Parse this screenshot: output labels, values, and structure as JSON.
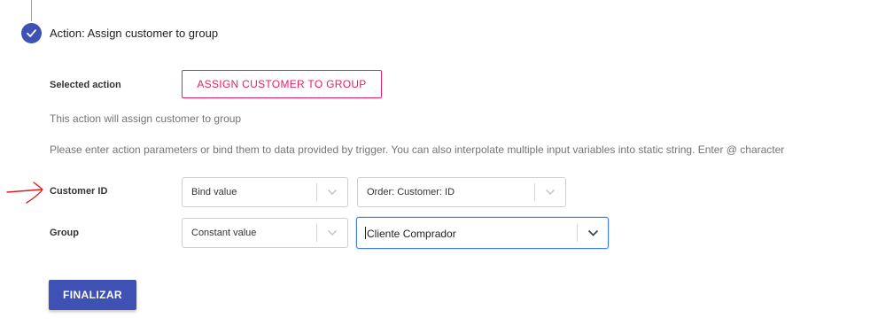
{
  "step": {
    "title": "Action: Assign customer to group",
    "icon": "check-icon",
    "status_color": "#3f51b5"
  },
  "selected_action": {
    "label": "Selected action",
    "value": "ASSIGN CUSTOMER TO GROUP",
    "accent_color": "#e91e63"
  },
  "description": "This action will assign customer to group",
  "instructions": "Please enter action parameters or bind them to data provided by trigger. You can also interpolate multiple input variables into static string. Enter @ character",
  "params": [
    {
      "label": "Customer ID",
      "mode": "Bind value",
      "value": "Order: Customer: ID"
    },
    {
      "label": "Group",
      "mode": "Constant value",
      "value": "Cliente Comprador"
    }
  ],
  "submit": {
    "label": "FINALIZAR",
    "color": "#3f51b5"
  }
}
